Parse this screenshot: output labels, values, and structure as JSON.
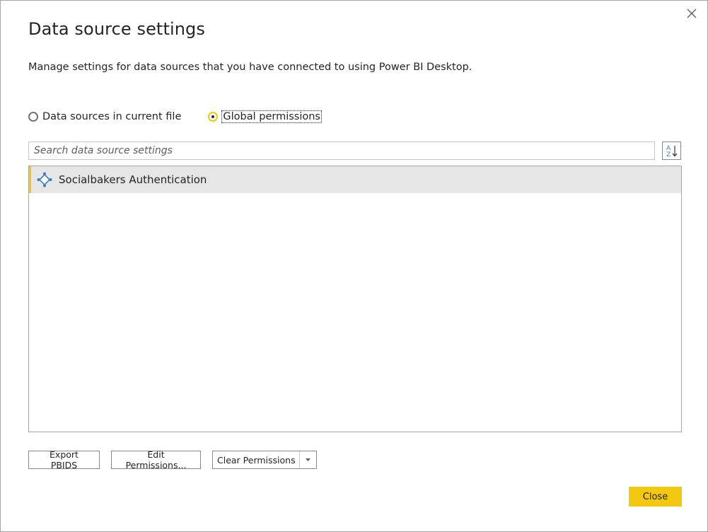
{
  "dialog": {
    "title": "Data source settings",
    "description": "Manage settings for data sources that you have connected to using Power BI Desktop."
  },
  "scope": {
    "options": [
      {
        "label": "Data sources in current file",
        "checked": false
      },
      {
        "label": "Global permissions",
        "checked": true
      }
    ]
  },
  "search": {
    "placeholder": "Search data source settings",
    "value": ""
  },
  "sort_icon": "sort-a-z-icon",
  "data_sources": [
    {
      "label": "Socialbakers Authentication",
      "icon": "connector-icon",
      "selected": true
    }
  ],
  "buttons": {
    "export": "Export PBIDS",
    "edit": "Edit Permissions...",
    "clear": "Clear Permissions",
    "close": "Close"
  },
  "colors": {
    "accent": "#f2c811",
    "selected_row": "#e6e6e6",
    "icon_blue": "#3c7dc4"
  }
}
